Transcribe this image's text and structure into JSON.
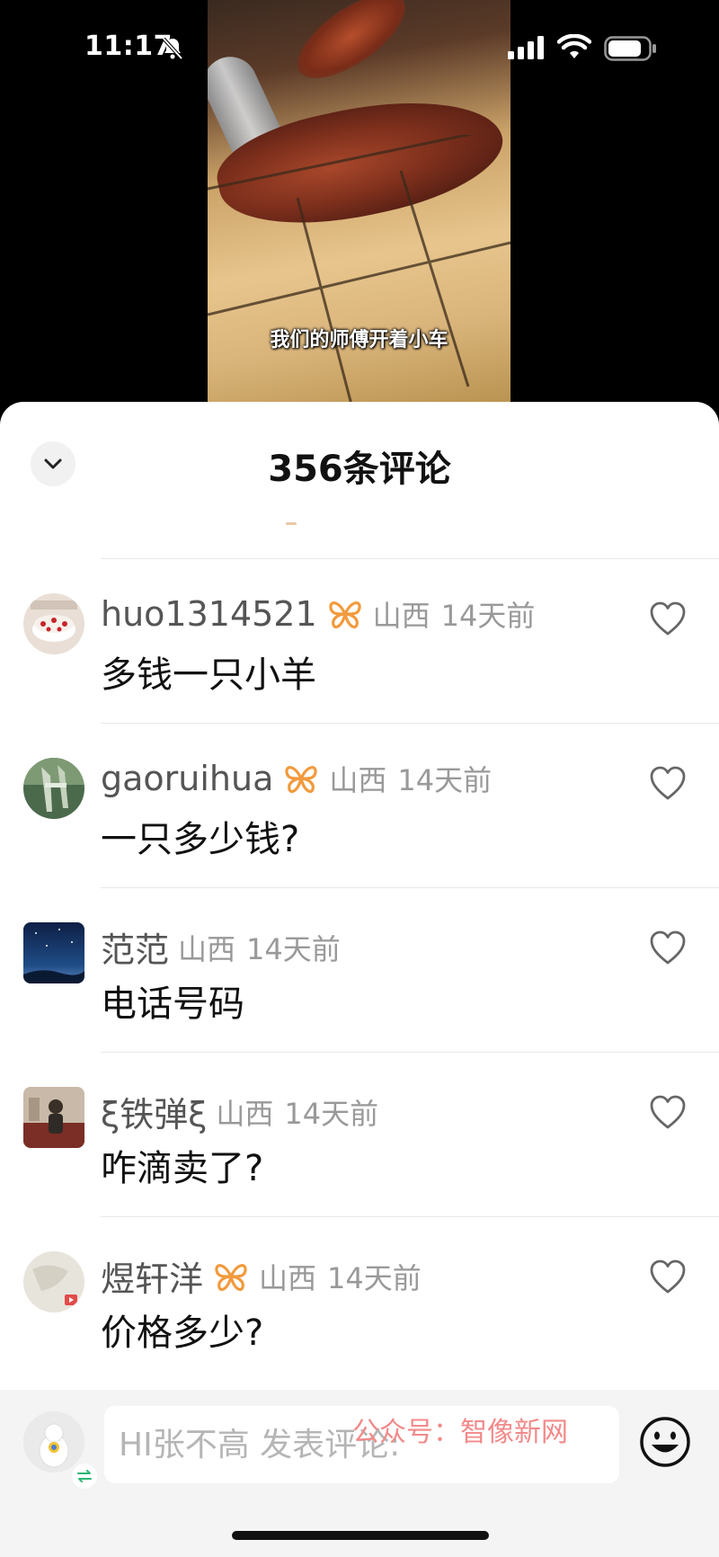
{
  "status_bar": {
    "time": "11:17"
  },
  "video": {
    "subtitle": "我们的师傅开着小车"
  },
  "sheet": {
    "title": "356条评论"
  },
  "comments": [
    {
      "username": "huo1314521",
      "has_badge": true,
      "location": "山西",
      "time": "14天前",
      "text": "多钱一只小羊"
    },
    {
      "username": "gaoruihua",
      "has_badge": true,
      "location": "山西",
      "time": "14天前",
      "text": "一只多少钱?"
    },
    {
      "username": "范范",
      "has_badge": false,
      "location": "山西",
      "time": "14天前",
      "text": "电话号码"
    },
    {
      "username": "ξ铁弹ξ",
      "has_badge": false,
      "location": "山西",
      "time": "14天前",
      "text": "咋滴卖了?"
    },
    {
      "username": "煜轩洋",
      "has_badge": true,
      "location": "山西",
      "time": "14天前",
      "text": "价格多少?"
    }
  ],
  "input": {
    "placeholder": "HI张不高 发表评论:"
  },
  "watermark": "公众号：智像新网",
  "icons": {
    "collapse": "chevron-down-icon",
    "like": "heart-outline-icon",
    "badge": "butterfly-badge-icon",
    "emoji": "smiley-icon",
    "switch": "switch-arrows-icon"
  },
  "colors": {
    "badge": "#f29a3d",
    "watermark": "#f28a8a",
    "sheet_bg": "#ffffff",
    "input_bar_bg": "#f4f4f4"
  }
}
